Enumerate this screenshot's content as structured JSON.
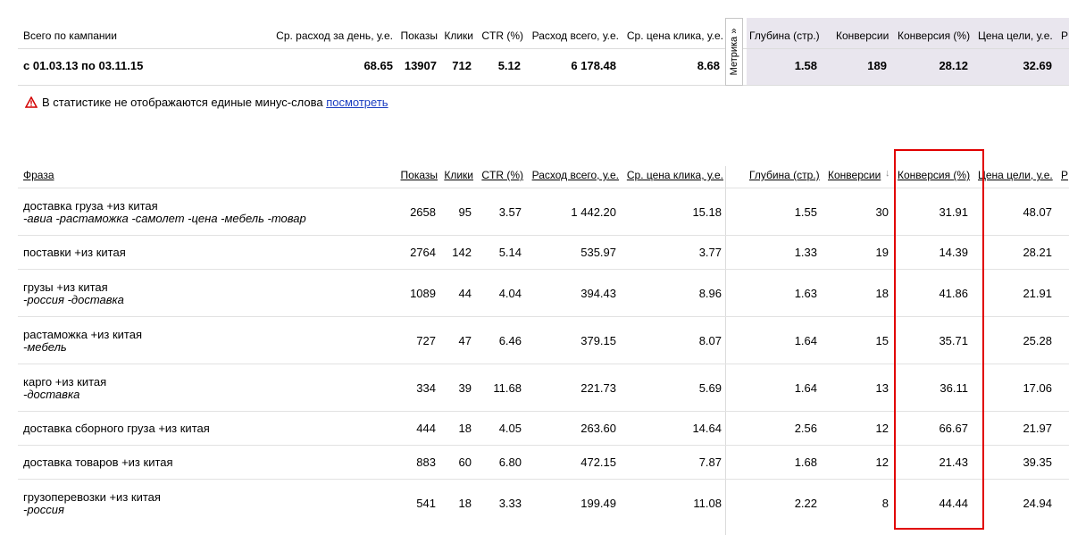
{
  "summary": {
    "header": {
      "label": "Всего по кампании",
      "avg_daily": "Ср. расход за день, у.е.",
      "impressions": "Показы",
      "clicks": "Клики",
      "ctr": "CTR (%)",
      "total_spend": "Расход всего, у.е.",
      "avg_cpc": "Ср. цена клика, у.е.",
      "depth": "Глубина (стр.)",
      "conversions": "Конверсии",
      "conv_rate": "Конверсия (%)",
      "goal_price": "Цена цели, у.е.",
      "cut": "Р"
    },
    "values": {
      "period": "с 01.03.13 по 03.11.15",
      "avg_daily": "68.65",
      "impressions": "13907",
      "clicks": "712",
      "ctr": "5.12",
      "total_spend": "6 178.48",
      "avg_cpc": "8.68",
      "depth": "1.58",
      "conversions": "189",
      "conv_rate": "28.12",
      "goal_price": "32.69"
    }
  },
  "metrika_tab": "Метрика »",
  "warning": {
    "text": "В статистике не отображаются единые минус-слова",
    "link": "посмотреть",
    "icon": "warning-triangle-icon",
    "icon_color": "#d40000"
  },
  "table": {
    "headers": {
      "phrase": "Фраза",
      "impressions": "Показы",
      "clicks": "Клики",
      "ctr": "CTR (%)",
      "total_spend": "Расход всего, у.е.",
      "avg_cpc": "Ср. цена клика, у.е.",
      "depth": "Глубина (стр.)",
      "conversions": "Конверсии",
      "sort_arrow": "↓",
      "conv_rate": "Конверсия (%)",
      "goal_price": "Цена цели, у.е.",
      "cut": "Р"
    },
    "rows": [
      {
        "phrase": "доставка груза +из китая",
        "neg": "-авиа -растаможка -самолет -цена -мебель -товар",
        "impressions": "2658",
        "clicks": "95",
        "ctr": "3.57",
        "total_spend": "1 442.20",
        "avg_cpc": "15.18",
        "depth": "1.55",
        "conversions": "30",
        "conv_rate": "31.91",
        "goal_price": "48.07"
      },
      {
        "phrase": "поставки +из китая",
        "neg": "",
        "impressions": "2764",
        "clicks": "142",
        "ctr": "5.14",
        "total_spend": "535.97",
        "avg_cpc": "3.77",
        "depth": "1.33",
        "conversions": "19",
        "conv_rate": "14.39",
        "goal_price": "28.21"
      },
      {
        "phrase": "грузы +из китая",
        "neg": "-россия -доставка",
        "impressions": "1089",
        "clicks": "44",
        "ctr": "4.04",
        "total_spend": "394.43",
        "avg_cpc": "8.96",
        "depth": "1.63",
        "conversions": "18",
        "conv_rate": "41.86",
        "goal_price": "21.91"
      },
      {
        "phrase": "растаможка +из китая",
        "neg": "-мебель",
        "impressions": "727",
        "clicks": "47",
        "ctr": "6.46",
        "total_spend": "379.15",
        "avg_cpc": "8.07",
        "depth": "1.64",
        "conversions": "15",
        "conv_rate": "35.71",
        "goal_price": "25.28"
      },
      {
        "phrase": "карго +из китая",
        "neg": "-доставка",
        "impressions": "334",
        "clicks": "39",
        "ctr": "11.68",
        "total_spend": "221.73",
        "avg_cpc": "5.69",
        "depth": "1.64",
        "conversions": "13",
        "conv_rate": "36.11",
        "goal_price": "17.06"
      },
      {
        "phrase": "доставка сборного груза +из китая",
        "neg": "",
        "impressions": "444",
        "clicks": "18",
        "ctr": "4.05",
        "total_spend": "263.60",
        "avg_cpc": "14.64",
        "depth": "2.56",
        "conversions": "12",
        "conv_rate": "66.67",
        "goal_price": "21.97"
      },
      {
        "phrase": "доставка товаров +из китая",
        "neg": "",
        "impressions": "883",
        "clicks": "60",
        "ctr": "6.80",
        "total_spend": "472.15",
        "avg_cpc": "7.87",
        "depth": "1.68",
        "conversions": "12",
        "conv_rate": "21.43",
        "goal_price": "39.35"
      },
      {
        "phrase": "грузоперевозки +из китая",
        "neg": "-россия",
        "impressions": "541",
        "clicks": "18",
        "ctr": "3.33",
        "total_spend": "199.49",
        "avg_cpc": "11.08",
        "depth": "2.22",
        "conversions": "8",
        "conv_rate": "44.44",
        "goal_price": "24.94"
      }
    ]
  },
  "highlight_color": "#e10000"
}
